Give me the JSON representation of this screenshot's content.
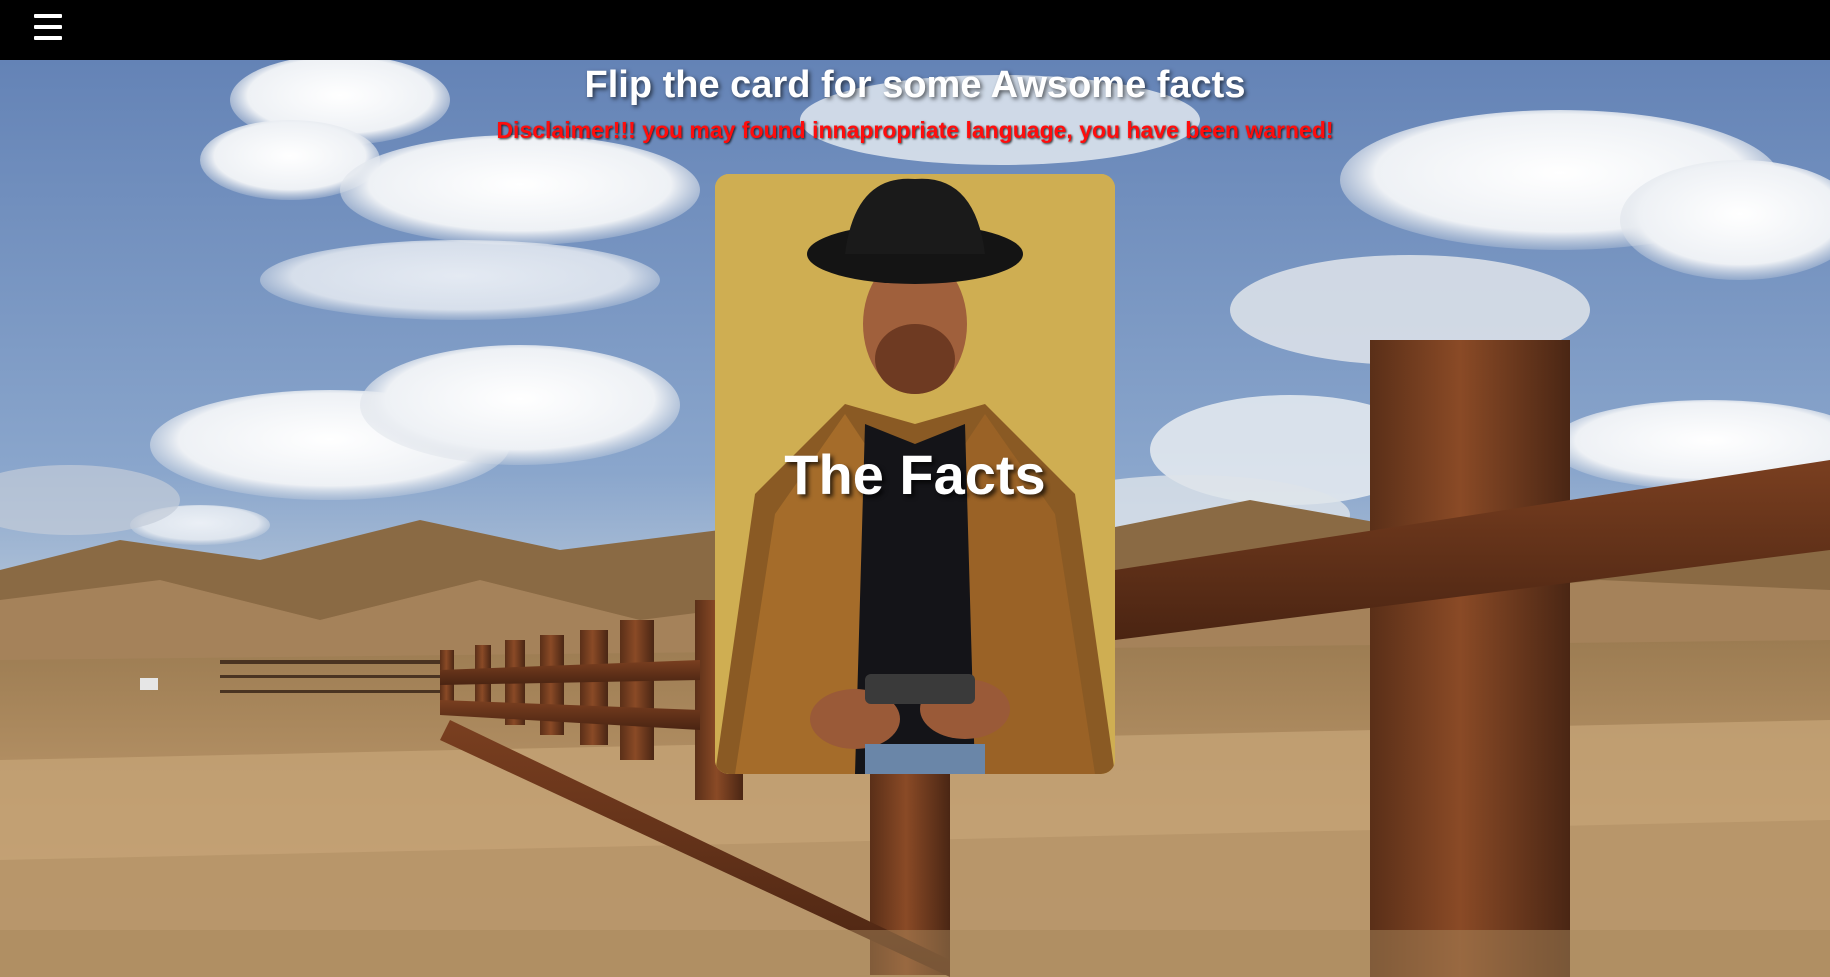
{
  "nav": {
    "menu_icon": "hamburger-menu-icon"
  },
  "main": {
    "headline": "Flip the card for some Awsome facts",
    "disclaimer": "Disclaimer!!! you may found innapropriate language, you have been warned!"
  },
  "card": {
    "front_title": "The Facts"
  },
  "colors": {
    "topbar": "#000000",
    "disclaimer": "#ff0d0d",
    "card_background": "#cfae52",
    "sky": "#6e8fbf"
  }
}
